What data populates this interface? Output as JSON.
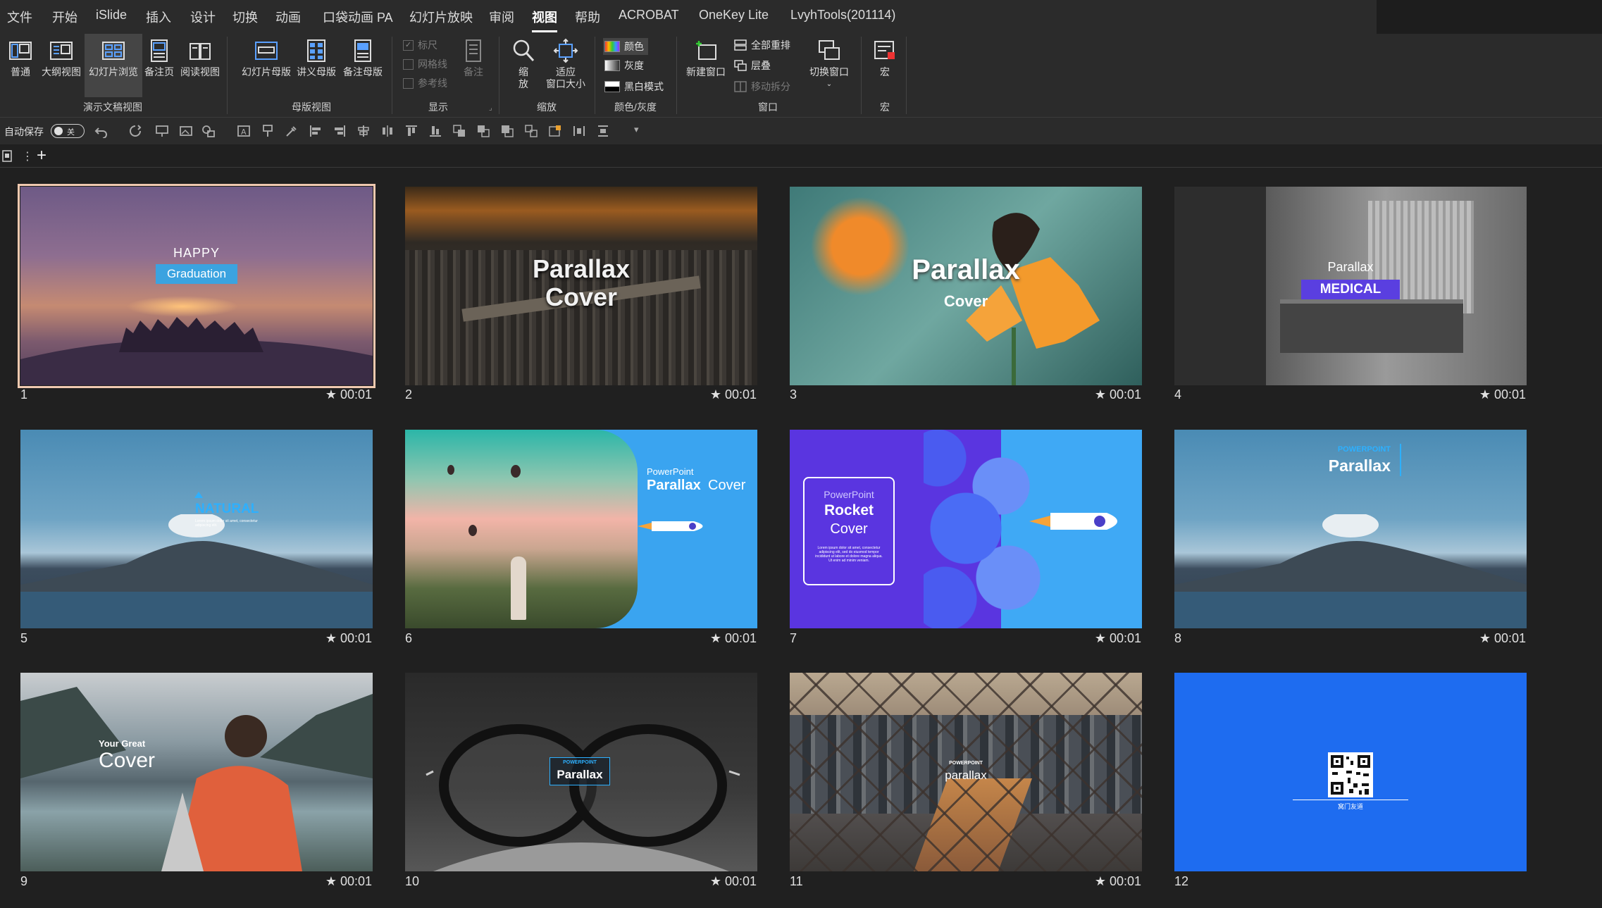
{
  "menu": {
    "tabs": [
      "文件",
      "开始",
      "iSlide",
      "插入",
      "设计",
      "切换",
      "动画",
      "口袋动画 PA",
      "幻灯片放映",
      "审阅",
      "视图",
      "帮助",
      "ACROBAT",
      "OneKey Lite",
      "LvyhTools(201114)"
    ],
    "active": "视图"
  },
  "ribbon": {
    "presentation_views": {
      "label": "演示文稿视图",
      "buttons": [
        "普通",
        "大纲视图",
        "幻灯片浏览",
        "备注页",
        "阅读视图"
      ]
    },
    "master_views": {
      "label": "母版视图",
      "buttons": [
        "幻灯片母版",
        "讲义母版",
        "备注母版"
      ]
    },
    "show": {
      "label": "显示",
      "checks": [
        "标尺",
        "网格线",
        "参考线"
      ],
      "notes": "备注"
    },
    "zoom": {
      "label": "缩放",
      "zoom_line1": "缩",
      "zoom_line2": "放",
      "fit_line1": "适应",
      "fit_line2": "窗口大小"
    },
    "color": {
      "label": "颜色/灰度",
      "options": [
        "颜色",
        "灰度",
        "黑白模式"
      ]
    },
    "window": {
      "label": "窗口",
      "new_window": "新建窗口",
      "arrange_all": "全部重排",
      "cascade": "层叠",
      "move_split": "移动拆分",
      "switch_window": "切换窗口"
    },
    "macros": {
      "label": "宏",
      "button": "宏"
    }
  },
  "qat": {
    "autosave": "自动保存",
    "toggle": "关"
  },
  "slides": [
    {
      "n": "1",
      "t": "★ 00:01",
      "line1": "HAPPY",
      "line2": "Graduation"
    },
    {
      "n": "2",
      "t": "★ 00:01",
      "line1": "Parallax",
      "line2": "Cover"
    },
    {
      "n": "3",
      "t": "★ 00:01",
      "line1": "Parallax",
      "line2": "Cover"
    },
    {
      "n": "4",
      "t": "★ 00:01",
      "line1": "Parallax",
      "line2": "MEDICAL"
    },
    {
      "n": "5",
      "t": "★ 00:01",
      "line1": "NATURAL",
      "line2": "Lorem ipsum dolor sit amet, consectetur adipiscing elit."
    },
    {
      "n": "6",
      "t": "★ 00:01",
      "line1": "PowerPoint",
      "line2": "Parallax",
      "line3": "Cover"
    },
    {
      "n": "7",
      "t": "★ 00:01",
      "line1": "PowerPoint",
      "line2": "Rocket",
      "line3": "Cover",
      "body": "Lorem ipsum dolor sit amet, consectetur adipiscing elit, sed do eiusmod tempor incididunt ut labore et dolore magna aliqua. Ut enim ad minim veniam."
    },
    {
      "n": "8",
      "t": "★ 00:01",
      "line1": "POWERPOINT",
      "line2": "Parallax"
    },
    {
      "n": "9",
      "t": "★ 00:01",
      "line1": "Your Great",
      "line2": "Cover"
    },
    {
      "n": "10",
      "t": "★ 00:01",
      "line1": "POWERPOINT",
      "line2": "Parallax"
    },
    {
      "n": "11",
      "t": "★ 00:01",
      "line1": "POWERPOINT",
      "line2": "parallax"
    },
    {
      "n": "12",
      "t": "",
      "line1": "",
      "line2": "窝门友道"
    }
  ]
}
